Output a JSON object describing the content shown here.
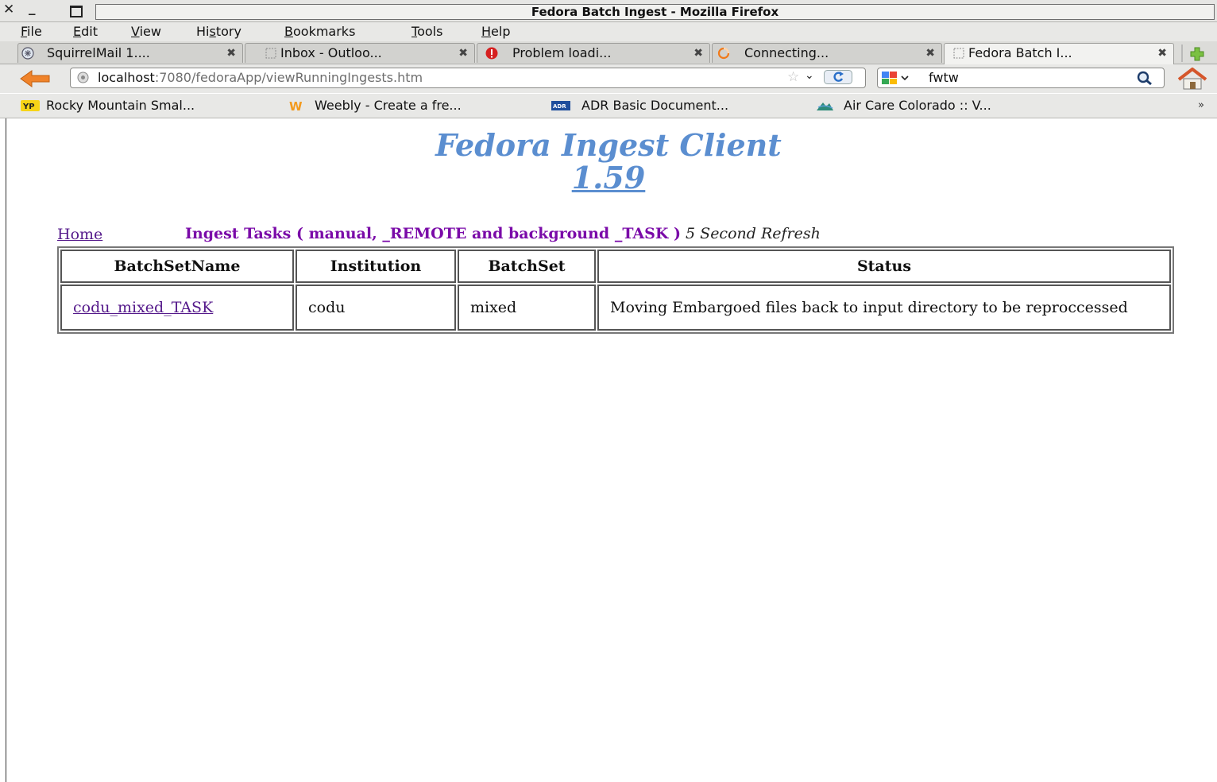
{
  "window": {
    "title": "Fedora Batch Ingest - Mozilla Firefox"
  },
  "menu": [
    "File",
    "Edit",
    "View",
    "History",
    "Bookmarks",
    "Tools",
    "Help"
  ],
  "tabs": [
    {
      "label": "SquirrelMail 1....",
      "icon": "squirrelmail-icon",
      "active": false
    },
    {
      "label": "Inbox - Outloo...",
      "icon": "page-icon",
      "active": false
    },
    {
      "label": "Problem loadi...",
      "icon": "error-icon",
      "active": false
    },
    {
      "label": "Connecting...",
      "icon": "loading-icon",
      "active": false
    },
    {
      "label": "Fedora Batch I...",
      "icon": "page-icon",
      "active": true
    }
  ],
  "navbar": {
    "url_host": "localhost",
    "url_rest": ":7080/fedoraApp/viewRunningIngests.htm",
    "search_value": "fwtw"
  },
  "bookmarks": [
    {
      "label": "Rocky Mountain Smal...",
      "icon": "yp-icon"
    },
    {
      "label": "Weebly - Create a fre...",
      "icon": "weebly-icon"
    },
    {
      "label": "ADR Basic Document...",
      "icon": "adr-icon"
    },
    {
      "label": "Air Care Colorado :: V...",
      "icon": "aircare-icon"
    }
  ],
  "bookmarks_more": "»",
  "page": {
    "title": "Fedora Ingest Client",
    "version": "1.59",
    "home_link": "Home",
    "heading": "Ingest Tasks ( manual, _REMOTE and background _TASK )",
    "refresh_note": "5 Second Refresh",
    "table": {
      "headers": [
        "BatchSetName",
        "Institution",
        "BatchSet",
        "Status"
      ],
      "rows": [
        {
          "batch_set_name": "codu_mixed_TASK",
          "institution": "codu",
          "batch_set": "mixed",
          "status": "Moving Embargoed files back to input directory to be reproccessed"
        }
      ]
    }
  },
  "colors": {
    "title_blue": "#5b8ed0",
    "heading_purple": "#7a0aa8",
    "visited_link": "#551a8b"
  }
}
